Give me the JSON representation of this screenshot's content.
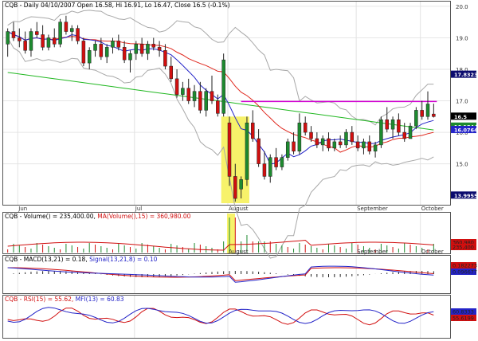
{
  "header": {
    "price": "CQB - Daily 04/10/2007 Open 16.58, Hi 16.91, Lo 16.47, Close 16.5 (-0.1%)",
    "volume": "CQB - Volume(",
    "volume_tail": ") = 235,400.00,",
    "ma_volume": "MA(Volume(",
    "ma_volume_tail": "),15) = 360,980.00",
    "macd": "CQB - MACD(13,21) = 0.18,",
    "signal": "Signal(13,21,8) = 0.10",
    "rsi": "CQB - RSI(15) = 55.62,",
    "mfi": "MFI(13) = 60.83"
  },
  "colors": {
    "up": "#1d8a2f",
    "down": "#d10f0f",
    "ma_fast": "#2424c8",
    "ma_mid": "#e0281e",
    "ma_slow": "#22b822",
    "bollinger": "#a8a8a8",
    "resistance": "#d200d2",
    "highlight": "#f7f26a",
    "tag_bg": "#0b0b6e"
  },
  "chart_data": [
    {
      "type": "candlestick",
      "title": "CQB - Daily 04/10/2007 Open 16.58, Hi 16.91, Lo 16.47, Close 16.5 (-0.1%)",
      "x_tick_labels": [
        "Jun",
        "Jul",
        "August",
        "September",
        "October"
      ],
      "y_tick_labels": [
        "20.0",
        "19.0",
        "18.0",
        "17.0",
        "16.0",
        "15.0"
      ],
      "ylim": [
        13.7,
        20.15
      ],
      "price_tags": [
        "17.8323",
        "16.5",
        "16.1844",
        "16.0764",
        "13.9955"
      ],
      "resistance_level": 16.98,
      "ohlc": [
        {
          "o": 18.8,
          "h": 19.3,
          "l": 18.4,
          "c": 19.2
        },
        {
          "o": 19.2,
          "h": 19.5,
          "l": 18.9,
          "c": 19.0
        },
        {
          "o": 19.0,
          "h": 19.3,
          "l": 18.7,
          "c": 18.9
        },
        {
          "o": 18.9,
          "h": 19.2,
          "l": 18.5,
          "c": 18.6
        },
        {
          "o": 18.6,
          "h": 19.3,
          "l": 18.4,
          "c": 19.2
        },
        {
          "o": 19.2,
          "h": 19.5,
          "l": 19.0,
          "c": 19.1
        },
        {
          "o": 19.1,
          "h": 19.4,
          "l": 18.6,
          "c": 18.7
        },
        {
          "o": 18.7,
          "h": 19.1,
          "l": 18.6,
          "c": 19.0
        },
        {
          "o": 19.0,
          "h": 19.3,
          "l": 18.7,
          "c": 18.8
        },
        {
          "o": 18.8,
          "h": 19.6,
          "l": 18.7,
          "c": 19.5
        },
        {
          "o": 19.5,
          "h": 19.7,
          "l": 19.1,
          "c": 19.2
        },
        {
          "o": 19.2,
          "h": 19.4,
          "l": 18.9,
          "c": 19.3
        },
        {
          "o": 19.3,
          "h": 19.4,
          "l": 18.8,
          "c": 18.9
        },
        {
          "o": 18.9,
          "h": 19.0,
          "l": 18.1,
          "c": 18.2
        },
        {
          "o": 18.2,
          "h": 18.7,
          "l": 18.0,
          "c": 18.6
        },
        {
          "o": 18.6,
          "h": 18.9,
          "l": 18.4,
          "c": 18.8
        },
        {
          "o": 18.8,
          "h": 19.0,
          "l": 18.3,
          "c": 18.4
        },
        {
          "o": 18.4,
          "h": 18.8,
          "l": 18.2,
          "c": 18.7
        },
        {
          "o": 18.7,
          "h": 19.0,
          "l": 18.5,
          "c": 18.9
        },
        {
          "o": 18.9,
          "h": 19.1,
          "l": 18.6,
          "c": 18.7
        },
        {
          "o": 18.7,
          "h": 18.9,
          "l": 18.2,
          "c": 18.3
        },
        {
          "o": 18.3,
          "h": 18.6,
          "l": 17.9,
          "c": 18.5
        },
        {
          "o": 18.5,
          "h": 18.9,
          "l": 18.3,
          "c": 18.8
        },
        {
          "o": 18.8,
          "h": 19.0,
          "l": 18.4,
          "c": 18.5
        },
        {
          "o": 18.5,
          "h": 18.9,
          "l": 18.3,
          "c": 18.8
        },
        {
          "o": 18.8,
          "h": 19.0,
          "l": 18.6,
          "c": 18.7
        },
        {
          "o": 18.7,
          "h": 18.9,
          "l": 18.4,
          "c": 18.6
        },
        {
          "o": 18.6,
          "h": 18.8,
          "l": 18.0,
          "c": 18.1
        },
        {
          "o": 18.1,
          "h": 18.4,
          "l": 17.6,
          "c": 17.7
        },
        {
          "o": 17.7,
          "h": 18.0,
          "l": 17.1,
          "c": 17.2
        },
        {
          "o": 17.2,
          "h": 17.6,
          "l": 17.0,
          "c": 17.4
        },
        {
          "o": 17.4,
          "h": 17.7,
          "l": 16.9,
          "c": 17.0
        },
        {
          "o": 17.0,
          "h": 17.5,
          "l": 16.8,
          "c": 17.3
        },
        {
          "o": 17.3,
          "h": 17.6,
          "l": 16.6,
          "c": 16.7
        },
        {
          "o": 16.7,
          "h": 17.4,
          "l": 16.5,
          "c": 17.3
        },
        {
          "o": 17.3,
          "h": 17.8,
          "l": 16.9,
          "c": 17.0
        },
        {
          "o": 17.0,
          "h": 17.2,
          "l": 16.5,
          "c": 16.6
        },
        {
          "o": 16.6,
          "h": 18.5,
          "l": 16.5,
          "c": 18.3
        },
        {
          "o": 16.3,
          "h": 16.5,
          "l": 14.3,
          "c": 14.6
        },
        {
          "o": 14.6,
          "h": 15.0,
          "l": 13.8,
          "c": 13.9
        },
        {
          "o": 14.2,
          "h": 14.6,
          "l": 13.9,
          "c": 14.5
        },
        {
          "o": 14.5,
          "h": 16.5,
          "l": 14.3,
          "c": 16.3
        },
        {
          "o": 16.3,
          "h": 16.7,
          "l": 15.7,
          "c": 15.8
        },
        {
          "o": 15.8,
          "h": 16.1,
          "l": 14.9,
          "c": 15.0
        },
        {
          "o": 15.0,
          "h": 15.4,
          "l": 14.5,
          "c": 14.6
        },
        {
          "o": 14.6,
          "h": 15.3,
          "l": 14.4,
          "c": 15.2
        },
        {
          "o": 15.2,
          "h": 15.5,
          "l": 14.8,
          "c": 14.9
        },
        {
          "o": 14.9,
          "h": 15.3,
          "l": 14.8,
          "c": 15.2
        },
        {
          "o": 15.2,
          "h": 15.8,
          "l": 15.1,
          "c": 15.7
        },
        {
          "o": 15.7,
          "h": 16.0,
          "l": 15.3,
          "c": 15.4
        },
        {
          "o": 15.4,
          "h": 16.6,
          "l": 15.3,
          "c": 16.3
        },
        {
          "o": 16.3,
          "h": 16.5,
          "l": 15.9,
          "c": 16.0
        },
        {
          "o": 16.0,
          "h": 16.2,
          "l": 15.7,
          "c": 15.8
        },
        {
          "o": 15.8,
          "h": 16.0,
          "l": 15.5,
          "c": 15.6
        },
        {
          "o": 15.6,
          "h": 15.9,
          "l": 15.4,
          "c": 15.8
        },
        {
          "o": 15.8,
          "h": 16.0,
          "l": 15.4,
          "c": 15.5
        },
        {
          "o": 15.5,
          "h": 15.8,
          "l": 15.4,
          "c": 15.7
        },
        {
          "o": 15.7,
          "h": 15.9,
          "l": 15.5,
          "c": 15.6
        },
        {
          "o": 15.6,
          "h": 16.1,
          "l": 15.5,
          "c": 16.0
        },
        {
          "o": 16.0,
          "h": 16.2,
          "l": 15.6,
          "c": 15.7
        },
        {
          "o": 15.7,
          "h": 15.9,
          "l": 15.4,
          "c": 15.5
        },
        {
          "o": 15.5,
          "h": 15.8,
          "l": 15.3,
          "c": 15.7
        },
        {
          "o": 15.7,
          "h": 15.9,
          "l": 15.3,
          "c": 15.4
        },
        {
          "o": 15.4,
          "h": 15.7,
          "l": 15.2,
          "c": 15.6
        },
        {
          "o": 15.6,
          "h": 16.5,
          "l": 15.5,
          "c": 16.4
        },
        {
          "o": 16.4,
          "h": 16.8,
          "l": 16.0,
          "c": 16.1
        },
        {
          "o": 16.1,
          "h": 16.5,
          "l": 15.8,
          "c": 16.4
        },
        {
          "o": 16.4,
          "h": 16.6,
          "l": 15.9,
          "c": 16.0
        },
        {
          "o": 16.0,
          "h": 16.3,
          "l": 15.7,
          "c": 15.8
        },
        {
          "o": 15.8,
          "h": 16.3,
          "l": 15.8,
          "c": 16.2
        },
        {
          "o": 16.2,
          "h": 16.8,
          "l": 16.1,
          "c": 16.7
        },
        {
          "o": 16.7,
          "h": 17.0,
          "l": 16.4,
          "c": 16.5
        },
        {
          "o": 16.5,
          "h": 17.3,
          "l": 16.4,
          "c": 16.9
        },
        {
          "o": 16.58,
          "h": 16.91,
          "l": 16.47,
          "c": 16.5
        }
      ]
    },
    {
      "type": "bar",
      "title": "Volume",
      "y_tick_labels": [
        "360,980",
        "235,400"
      ]
    },
    {
      "type": "line",
      "title": "MACD",
      "y_tick_labels": [
        "0.182273",
        "0.096677"
      ]
    },
    {
      "type": "line",
      "title": "RSI / MFI",
      "y_tick_labels": [
        "60.8333",
        "55.6199"
      ]
    }
  ]
}
